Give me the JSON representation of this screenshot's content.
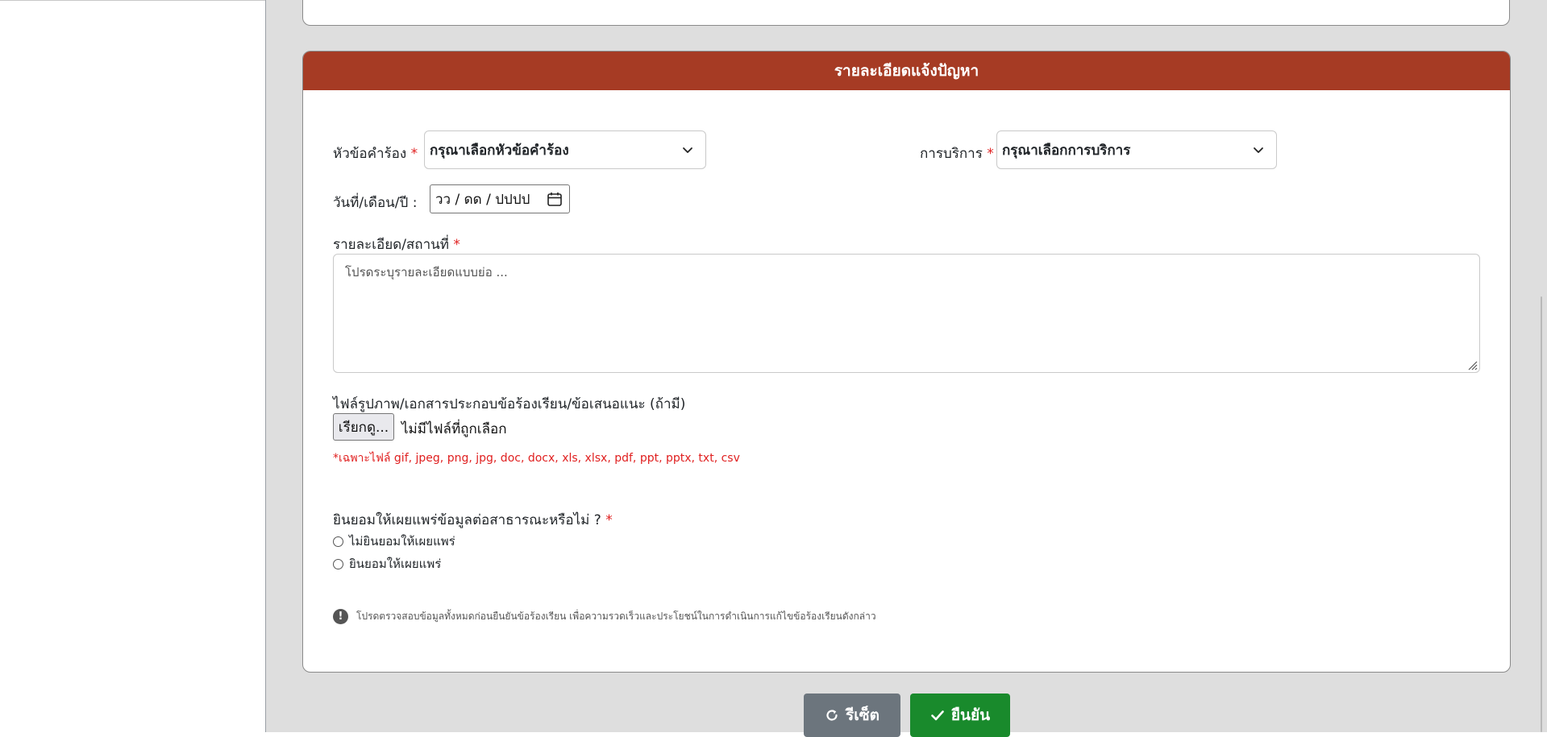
{
  "card": {
    "header_title": "รายละเอียดแจ้งปัญหา"
  },
  "form": {
    "topic": {
      "label": "หัวข้อคำร้อง",
      "required_mark": "*",
      "selected": "กรุณาเลือกหัวข้อคำร้อง"
    },
    "service": {
      "label": "การบริการ",
      "required_mark": "*",
      "selected": "กรุณาเลือกการบริการ"
    },
    "date": {
      "label": "วันที่/เดือน/ปี :",
      "value": "วว / ดด / ปปปป"
    },
    "detail": {
      "label": "รายละเอียด/สถานที่",
      "required_mark": "*",
      "placeholder": "โปรดระบุรายละเอียดแบบย่อ ..."
    },
    "file": {
      "label": "ไฟล์รูปภาพ/เอกสารประกอบข้อร้องเรียน/ข้อเสนอแนะ",
      "optional": "(ถ้ามี)",
      "button": "เรียกดู...",
      "status": "ไม่มีไฟล์ที่ถูกเลือก",
      "note": "*เฉพาะไฟล์ gif, jpeg, png, jpg, doc, docx, xls, xlsx, pdf, ppt, pptx, txt, csv"
    },
    "consent": {
      "question": "ยินยอมให้เผยแพร่ข้อมูลต่อสาธารณะหรือไม่ ?",
      "required_mark": "*",
      "options": [
        "ไม่ยินยอมให้เผยแพร่",
        "ยินยอมให้เผยแพร่"
      ]
    },
    "notice": "โปรดตรวจสอบข้อมูลทั้งหมดก่อนยืนยันข้อร้องเรียน เพื่อความรวดเร็วและประโยชน์ในการดำเนินการแก้ไขข้อร้องเรียนดังกล่าว"
  },
  "buttons": {
    "reset": "รีเซ็ต",
    "submit": "ยืนยัน"
  },
  "colors": {
    "header": "#a63b24",
    "required": "#e02020",
    "reset": "#6c757d",
    "submit": "#198a2c"
  }
}
